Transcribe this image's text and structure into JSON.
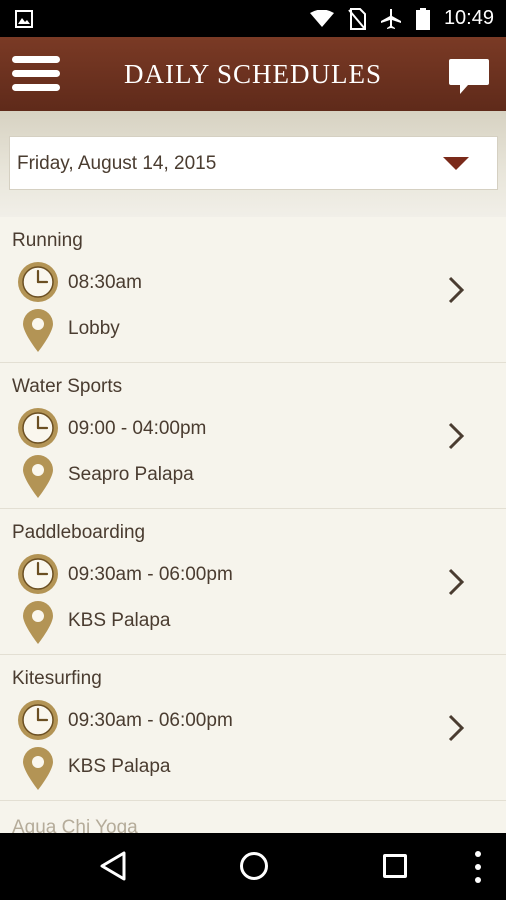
{
  "status_bar": {
    "time": "10:49",
    "icons": [
      "image-icon",
      "wifi-icon",
      "no-sim-icon",
      "airplane-icon",
      "battery-icon"
    ]
  },
  "header": {
    "title": "DAILY SCHEDULES",
    "icons": [
      "menu-icon",
      "chat-icon"
    ]
  },
  "date_selector": {
    "value": "Friday, August 14, 2015",
    "icon": "dropdown-arrow-icon"
  },
  "schedule": {
    "items": [
      {
        "name": "Running",
        "time": "08:30am",
        "location": "Lobby"
      },
      {
        "name": "Water Sports",
        "time": "09:00 - 04:00pm",
        "location": "Seapro Palapa"
      },
      {
        "name": "Paddleboarding",
        "time": "09:30am - 06:00pm",
        "location": "KBS Palapa"
      },
      {
        "name": "Kitesurfing",
        "time": "09:30am - 06:00pm",
        "location": "KBS Palapa"
      }
    ],
    "partial_item": "Aqua Chi Yoga"
  },
  "colors": {
    "header_brown": "#6b3120",
    "gold": "#b39455",
    "text": "#4a3c30",
    "accent_arrow": "#7a2a1a"
  },
  "nav_bar": {
    "icons": [
      "back-icon",
      "home-icon",
      "recents-icon",
      "more-icon"
    ]
  }
}
